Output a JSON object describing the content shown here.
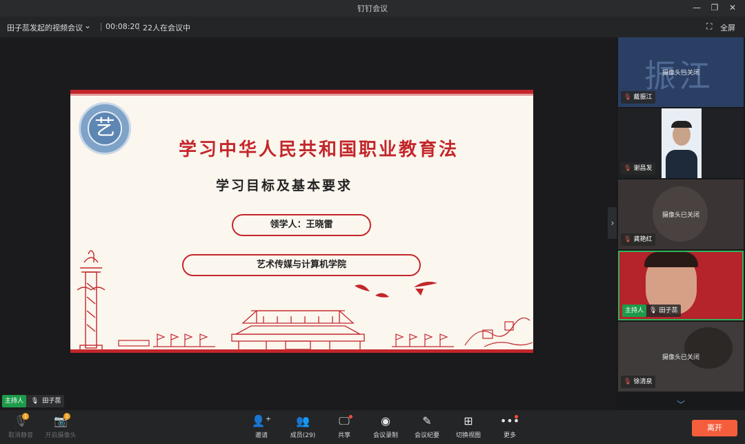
{
  "window": {
    "title": "钉钉会议"
  },
  "infobar": {
    "meeting_name": "田子蕊发起的视频会议",
    "duration": "00:08:20",
    "participants_count": "22人在会议中",
    "fullscreen_label": "全屏"
  },
  "slide": {
    "main_title": "学习中华人民共和国职业教育法",
    "sub_title": "学习目标及基本要求",
    "leader": "领学人：王晓雷",
    "college": "艺术传媒与计算机学院"
  },
  "participants": [
    {
      "name": "戴振江",
      "status": "摄像头已关闭",
      "bg_text": "振江"
    },
    {
      "name": "谢昌发",
      "status": ""
    },
    {
      "name": "龚艳红",
      "status": "摄像头已关闭"
    },
    {
      "name": "田子蕊",
      "status": "",
      "host_label": "主持人"
    },
    {
      "name": "徐清泉",
      "status": "摄像头已关闭"
    }
  ],
  "main_speaker": {
    "host_label": "主持人",
    "name": "田子蕊"
  },
  "toolbar": {
    "unmute_label": "取消静音",
    "camera_label": "开启摄像头",
    "invite_label": "邀请",
    "members_label": "成员(29)",
    "share_label": "共享",
    "record_label": "会议录制",
    "minutes_label": "会议纪要",
    "view_label": "切换视图",
    "more_label": "更多",
    "leave_label": "离开",
    "badge_unmute": "1",
    "badge_camera": "1"
  },
  "colors": {
    "accent_red": "#c3262b",
    "leave": "#f55e3c",
    "host_green": "#1e9b4a",
    "active_border": "#2fb35a"
  }
}
